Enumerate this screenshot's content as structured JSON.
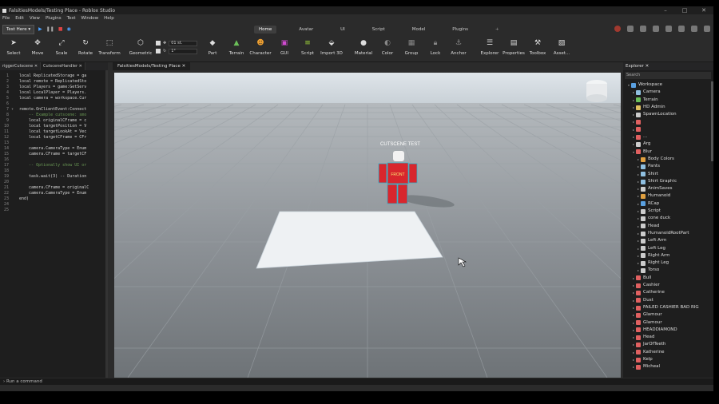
{
  "window": {
    "title": "FalsitiesModels/Testing Place - Roblox Studio"
  },
  "menu": [
    "File",
    "Edit",
    "View",
    "Plugins",
    "Test",
    "Window",
    "Help"
  ],
  "play_target": "Test Here",
  "ribbon_tabs": [
    {
      "label": "Home",
      "active": true
    },
    {
      "label": "Avatar",
      "active": false
    },
    {
      "label": "UI",
      "active": false
    },
    {
      "label": "Script",
      "active": false
    },
    {
      "label": "Model",
      "active": false
    },
    {
      "label": "Plugins",
      "active": false
    }
  ],
  "ribbon_plus": "+",
  "tools": [
    {
      "label": "Select",
      "icon": "select-arrow-icon",
      "color": "#dddddd"
    },
    {
      "label": "Move",
      "icon": "move-arrows-icon",
      "color": "#dddddd"
    },
    {
      "label": "Scale",
      "icon": "scale-icon",
      "color": "#dddddd"
    },
    {
      "label": "Rotate",
      "icon": "rotate-icon",
      "color": "#dddddd"
    },
    {
      "label": "Transform",
      "icon": "transform-icon",
      "color": "#dddddd"
    },
    {
      "label": "Geometric",
      "icon": "geometric-icon",
      "color": "#dddddd"
    },
    {
      "label": "Part",
      "icon": "part-cube-icon",
      "color": "#dddddd"
    },
    {
      "label": "Terrain",
      "icon": "terrain-icon",
      "color": "#6bbf59"
    },
    {
      "label": "Character",
      "icon": "character-icon",
      "color": "#f0a030"
    },
    {
      "label": "GUI",
      "icon": "gui-icon",
      "color": "#d04bd0"
    },
    {
      "label": "Script",
      "icon": "script-icon",
      "color": "#9fd43a"
    },
    {
      "label": "Import 3D",
      "icon": "import-3d-icon",
      "color": "#dddddd"
    },
    {
      "label": "Material",
      "icon": "material-icon",
      "color": "#dddddd"
    },
    {
      "label": "Color",
      "icon": "color-icon",
      "color": "#888888"
    },
    {
      "label": "Group",
      "icon": "group-icon",
      "color": "#888888"
    },
    {
      "label": "Lock",
      "icon": "lock-icon",
      "color": "#888888"
    },
    {
      "label": "Anchor",
      "icon": "anchor-icon",
      "color": "#888888"
    },
    {
      "label": "Explorer",
      "icon": "explorer-icon",
      "color": "#dddddd"
    },
    {
      "label": "Properties",
      "icon": "properties-icon",
      "color": "#dddddd"
    },
    {
      "label": "Toolbox",
      "icon": "toolbox-icon",
      "color": "#dddddd"
    },
    {
      "label": "Asset...",
      "icon": "asset-manager-icon",
      "color": "#dddddd"
    }
  ],
  "snap": {
    "move_value": "01 st.",
    "rotate_value": "1°"
  },
  "script_tabs": [
    {
      "label": "riggerCutscene",
      "active": false
    },
    {
      "label": "CutsceneHandler",
      "active": true
    }
  ],
  "code_lines": [
    "local ReplicatedStorage = ga",
    "local remote = ReplicatedSto",
    "local Players = game:GetServ",
    "local LocalPlayer = Players.",
    "local camera = workspace.Cur",
    "",
    "remote.OnClientEvent:Connect",
    "    -- Example cutscene: smo",
    "    local originalCFrame = c",
    "    local targetPosition = V",
    "    local targetLookAt = Vec",
    "    local targetCFrame = CFr",
    "",
    "    camera.CameraType = Enum",
    "    camera.CFrame = targetCF",
    "",
    "    -- Optionally show UI or",
    "",
    "    task.wait(3) -- Duration",
    "",
    "    camera.CFrame = originalC",
    "    camera.CameraType = Enum",
    "end)",
    "",
    ""
  ],
  "viewport_tab": "FalsitiesModels/Testing Place",
  "viewport": {
    "rig_label": "CUTSCENE TEST",
    "front_text": "FRONT"
  },
  "explorer": {
    "title": "Explorer",
    "search_placeholder": "Search",
    "items": [
      {
        "label": "Workspace",
        "depth": 0,
        "expanded": true,
        "icon_color": "#5aa0e0"
      },
      {
        "label": "Camera",
        "depth": 1,
        "expanded": false,
        "icon_color": "#8fbfe0"
      },
      {
        "label": "Terrain",
        "depth": 1,
        "expanded": false,
        "icon_color": "#6bbf59"
      },
      {
        "label": "HD Admin",
        "depth": 1,
        "expanded": false,
        "icon_color": "#e0c060"
      },
      {
        "label": "SpawnLocation",
        "depth": 1,
        "expanded": false,
        "icon_color": "#cccccc"
      },
      {
        "label": "",
        "depth": 1,
        "expanded": false,
        "icon_color": "#e06060"
      },
      {
        "label": "",
        "depth": 1,
        "expanded": false,
        "icon_color": "#e06060"
      },
      {
        "label": "...",
        "depth": 1,
        "expanded": false,
        "icon_color": "#e06060"
      },
      {
        "label": "Arg",
        "depth": 1,
        "expanded": false,
        "icon_color": "#cccccc"
      },
      {
        "label": "Blur",
        "depth": 1,
        "expanded": true,
        "icon_color": "#e06060"
      },
      {
        "label": "Body Colors",
        "depth": 2,
        "expanded": false,
        "icon_color": "#e0a040"
      },
      {
        "label": "Pants",
        "depth": 2,
        "expanded": false,
        "icon_color": "#8fbfe0"
      },
      {
        "label": "Shirt",
        "depth": 2,
        "expanded": false,
        "icon_color": "#8fbfe0"
      },
      {
        "label": "Shirt Graphic",
        "depth": 2,
        "expanded": false,
        "icon_color": "#8fbfe0"
      },
      {
        "label": "AnimSaves",
        "depth": 2,
        "expanded": false,
        "icon_color": "#cccccc"
      },
      {
        "label": "Humanoid",
        "depth": 2,
        "expanded": false,
        "icon_color": "#e0a040"
      },
      {
        "label": "RCap",
        "depth": 2,
        "expanded": false,
        "icon_color": "#5aa0e0"
      },
      {
        "label": "Script",
        "depth": 2,
        "expanded": false,
        "icon_color": "#cccccc"
      },
      {
        "label": "cone duck",
        "depth": 2,
        "expanded": false,
        "icon_color": "#cccccc"
      },
      {
        "label": "Head",
        "depth": 2,
        "expanded": false,
        "icon_color": "#cccccc"
      },
      {
        "label": "HumanoidRootPart",
        "depth": 2,
        "expanded": false,
        "icon_color": "#cccccc"
      },
      {
        "label": "Left Arm",
        "depth": 2,
        "expanded": false,
        "icon_color": "#cccccc"
      },
      {
        "label": "Left Leg",
        "depth": 2,
        "expanded": false,
        "icon_color": "#cccccc"
      },
      {
        "label": "Right Arm",
        "depth": 2,
        "expanded": false,
        "icon_color": "#cccccc"
      },
      {
        "label": "Right Leg",
        "depth": 2,
        "expanded": false,
        "icon_color": "#cccccc"
      },
      {
        "label": "Torso",
        "depth": 2,
        "expanded": false,
        "icon_color": "#cccccc"
      },
      {
        "label": "Bull",
        "depth": 1,
        "expanded": false,
        "icon_color": "#e06060"
      },
      {
        "label": "Cashier",
        "depth": 1,
        "expanded": false,
        "icon_color": "#e06060"
      },
      {
        "label": "Catherine",
        "depth": 1,
        "expanded": false,
        "icon_color": "#e06060"
      },
      {
        "label": "Dust",
        "depth": 1,
        "expanded": false,
        "icon_color": "#e06060"
      },
      {
        "label": "FAILED CASHIER BAD RIG",
        "depth": 1,
        "expanded": false,
        "icon_color": "#e06060"
      },
      {
        "label": "Glamour",
        "depth": 1,
        "expanded": false,
        "icon_color": "#e06060"
      },
      {
        "label": "Glamour",
        "depth": 1,
        "expanded": false,
        "icon_color": "#e06060"
      },
      {
        "label": "HEADDIAMOND",
        "depth": 1,
        "expanded": false,
        "icon_color": "#e06060"
      },
      {
        "label": "Head",
        "depth": 1,
        "expanded": false,
        "icon_color": "#e06060"
      },
      {
        "label": "JarOfTeeth",
        "depth": 1,
        "expanded": false,
        "icon_color": "#e06060"
      },
      {
        "label": "Katherine",
        "depth": 1,
        "expanded": false,
        "icon_color": "#e06060"
      },
      {
        "label": "Kelp",
        "depth": 1,
        "expanded": false,
        "icon_color": "#e06060"
      },
      {
        "label": "Micheal",
        "depth": 1,
        "expanded": false,
        "icon_color": "#e06060"
      }
    ]
  },
  "command_bar": {
    "placeholder": "Run a command"
  }
}
